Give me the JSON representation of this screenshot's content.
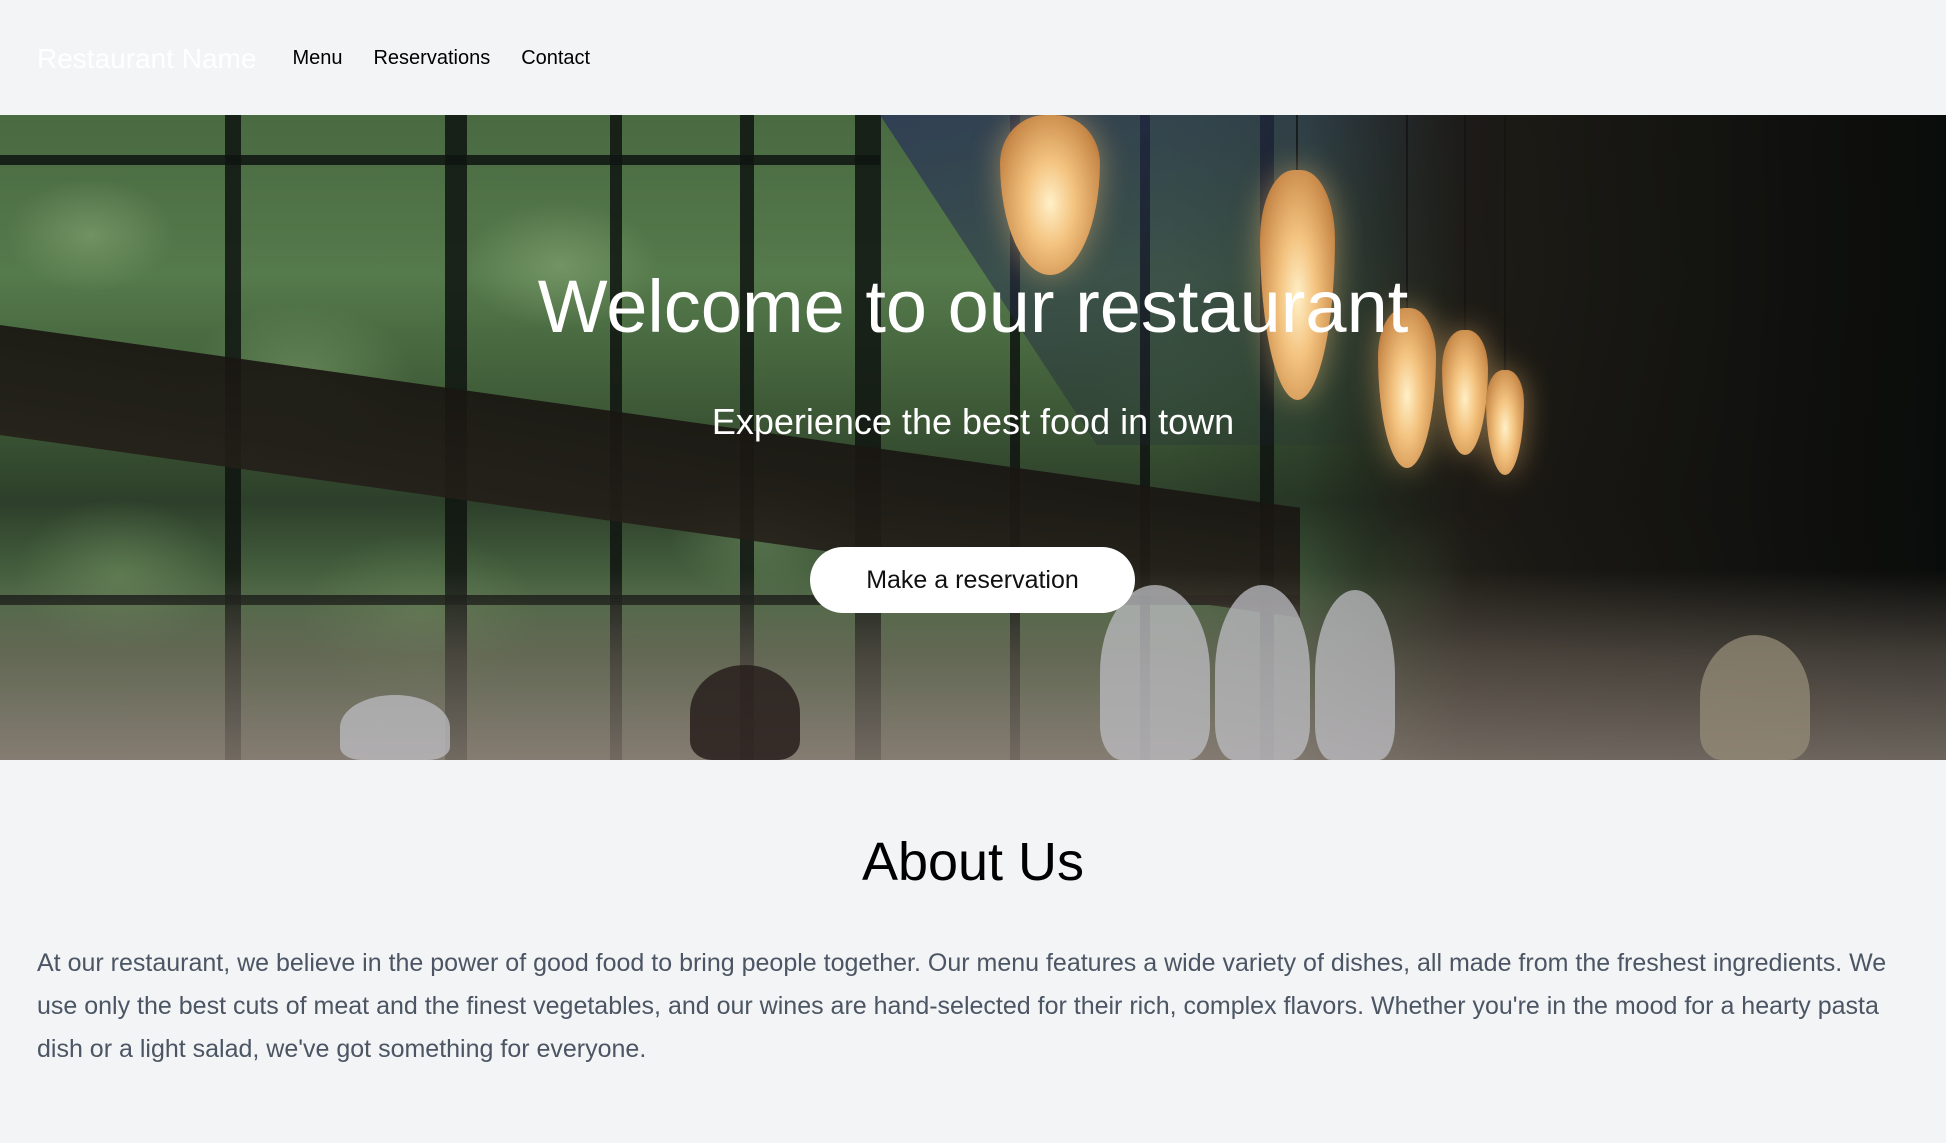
{
  "header": {
    "brand": "Restaurant Name",
    "nav": [
      {
        "label": "Menu"
      },
      {
        "label": "Reservations"
      },
      {
        "label": "Contact"
      }
    ]
  },
  "hero": {
    "title": "Welcome to our restaurant",
    "subtitle": "Experience the best food in town",
    "cta_label": "Make a reservation",
    "image_description": "Restaurant dining room with floor-to-ceiling windows overlooking a forest, hanging paper lanterns, diners at tables"
  },
  "about": {
    "title": "About Us",
    "text": "At our restaurant, we believe in the power of good food to bring people together. Our menu features a wide variety of dishes, all made from the freshest ingredients. We use only the best cuts of meat and the finest vegetables, and our wines are hand-selected for their rich, complex flavors. Whether you're in the mood for a hearty pasta dish or a light salad, we've got something for everyone."
  },
  "colors": {
    "page_background": "#f3f4f6",
    "brand_text": "#ffffff",
    "nav_text": "#000000",
    "hero_text": "#ffffff",
    "cta_background": "#ffffff",
    "cta_text": "#111111",
    "body_text": "#4b5563",
    "heading_text": "#000000"
  }
}
